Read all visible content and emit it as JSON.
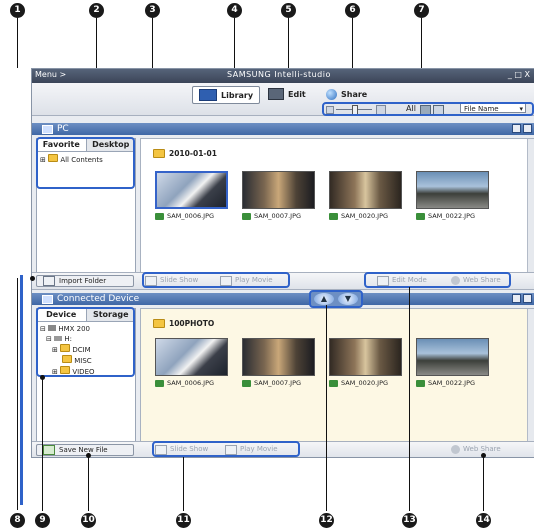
{
  "callouts": [
    "1",
    "2",
    "3",
    "4",
    "5",
    "6",
    "7",
    "8",
    "9",
    "10",
    "11",
    "12",
    "13",
    "14"
  ],
  "titlebar": {
    "menu": "Menu >",
    "app_title": "SAMSUNG Intelli-studio",
    "window_controls": "_ □ X"
  },
  "toolbar": {
    "tabs": [
      {
        "label": "Library"
      },
      {
        "label": "Edit"
      },
      {
        "label": "Share"
      }
    ],
    "view_mode_all": "All",
    "sort_select": "File Name"
  },
  "pc_panel": {
    "title": "PC",
    "side_tabs": [
      "Favorite",
      "Desktop"
    ],
    "tree_root": "All Contents",
    "folder_label": "2010-01-01",
    "thumbnails": [
      "SAM_0006.JPG",
      "SAM_0007.JPG",
      "SAM_0020.JPG",
      "SAM_0022.JPG"
    ],
    "import_button": "Import Folder",
    "actions": {
      "slide_show": "Slide Show",
      "play_movie": "Play Movie",
      "edit_mode": "Edit Mode",
      "web_share": "Web Share"
    }
  },
  "device_panel": {
    "title": "Connected Device",
    "side_tabs": [
      "Device",
      "Storage"
    ],
    "tree": [
      "HMX 200",
      "H:",
      "DCIM",
      "MISC",
      "VIDEO"
    ],
    "folder_label": "100PHOTO",
    "thumbnails": [
      "SAM_0006.JPG",
      "SAM_0007.JPG",
      "SAM_0020.JPG",
      "SAM_0022.JPG"
    ],
    "save_button": "Save New File",
    "actions": {
      "slide_show": "Slide Show",
      "play_movie": "Play Movie",
      "web_share": "Web Share"
    }
  },
  "icons": [
    "menu-icon",
    "library-icon",
    "edit-icon",
    "share-icon",
    "zoom-slider",
    "folder-icon",
    "camera-icon",
    "up-arrow-icon",
    "down-arrow-icon",
    "globe-icon"
  ]
}
